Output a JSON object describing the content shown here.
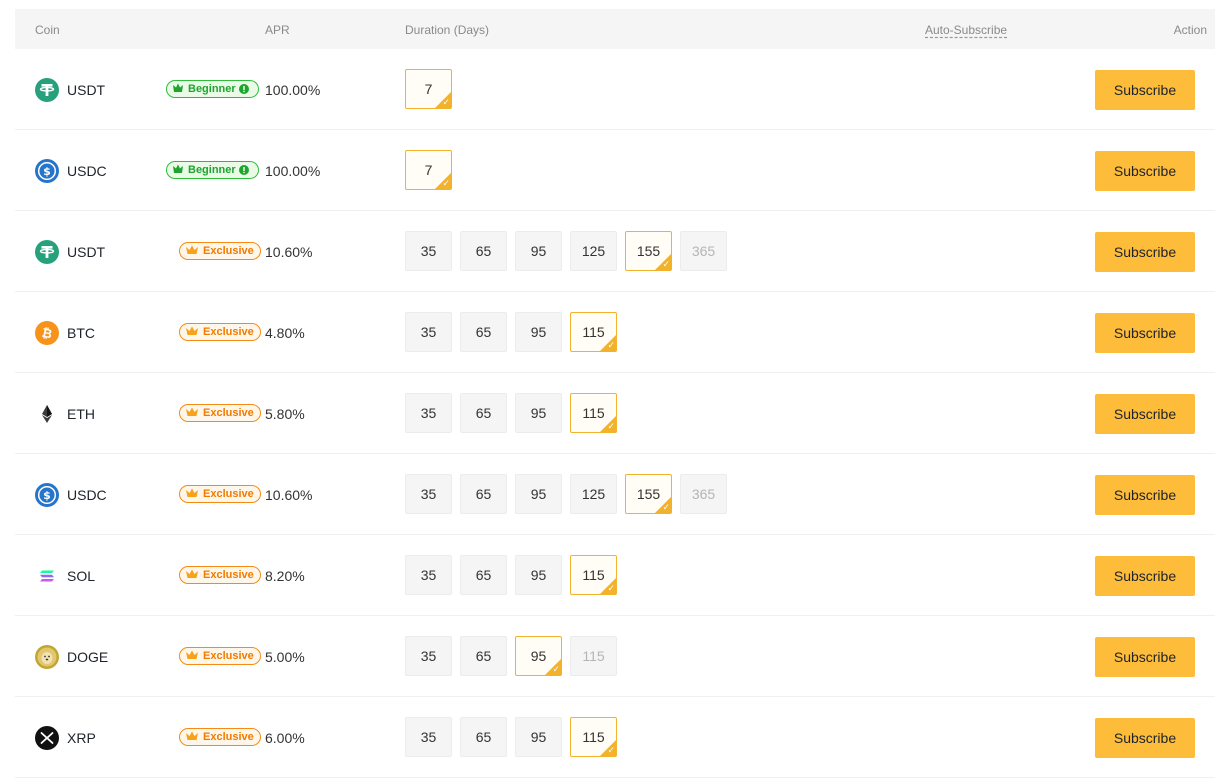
{
  "header": {
    "coin": "Coin",
    "apr": "APR",
    "duration": "Duration (Days)",
    "auto_subscribe": "Auto-Subscribe",
    "action": "Action"
  },
  "colors": {
    "accent": "#fdbc3a",
    "selected_border": "#f3b22c",
    "beginner_green": "#2dbd3b",
    "exclusive_orange": "#f58a14"
  },
  "rows": [
    {
      "coin": "USDT",
      "icon": "usdt-icon",
      "badge_type": "beginner",
      "badge": "Beginner",
      "apr": "100.00%",
      "durations": [
        "7"
      ],
      "selected": 0,
      "disabled": [],
      "button": "Subscribe"
    },
    {
      "coin": "USDC",
      "icon": "usdc-icon",
      "badge_type": "beginner",
      "badge": "Beginner",
      "apr": "100.00%",
      "durations": [
        "7"
      ],
      "selected": 0,
      "disabled": [],
      "button": "Subscribe"
    },
    {
      "coin": "USDT",
      "icon": "usdt-icon",
      "badge_type": "exclusive",
      "badge": "Exclusive",
      "apr": "10.60%",
      "durations": [
        "35",
        "65",
        "95",
        "125",
        "155",
        "365"
      ],
      "selected": 4,
      "disabled": [
        5
      ],
      "button": "Subscribe"
    },
    {
      "coin": "BTC",
      "icon": "btc-icon",
      "badge_type": "exclusive",
      "badge": "Exclusive",
      "apr": "4.80%",
      "durations": [
        "35",
        "65",
        "95",
        "115"
      ],
      "selected": 3,
      "disabled": [],
      "button": "Subscribe"
    },
    {
      "coin": "ETH",
      "icon": "eth-icon",
      "badge_type": "exclusive",
      "badge": "Exclusive",
      "apr": "5.80%",
      "durations": [
        "35",
        "65",
        "95",
        "115"
      ],
      "selected": 3,
      "disabled": [],
      "button": "Subscribe"
    },
    {
      "coin": "USDC",
      "icon": "usdc-icon",
      "badge_type": "exclusive",
      "badge": "Exclusive",
      "apr": "10.60%",
      "durations": [
        "35",
        "65",
        "95",
        "125",
        "155",
        "365"
      ],
      "selected": 4,
      "disabled": [
        5
      ],
      "button": "Subscribe"
    },
    {
      "coin": "SOL",
      "icon": "sol-icon",
      "badge_type": "exclusive",
      "badge": "Exclusive",
      "apr": "8.20%",
      "durations": [
        "35",
        "65",
        "95",
        "115"
      ],
      "selected": 3,
      "disabled": [],
      "button": "Subscribe"
    },
    {
      "coin": "DOGE",
      "icon": "doge-icon",
      "badge_type": "exclusive",
      "badge": "Exclusive",
      "apr": "5.00%",
      "durations": [
        "35",
        "65",
        "95",
        "115"
      ],
      "selected": 2,
      "disabled": [
        3
      ],
      "button": "Subscribe"
    },
    {
      "coin": "XRP",
      "icon": "xrp-icon",
      "badge_type": "exclusive",
      "badge": "Exclusive",
      "apr": "6.00%",
      "durations": [
        "35",
        "65",
        "95",
        "115"
      ],
      "selected": 3,
      "disabled": [],
      "button": "Subscribe"
    }
  ]
}
